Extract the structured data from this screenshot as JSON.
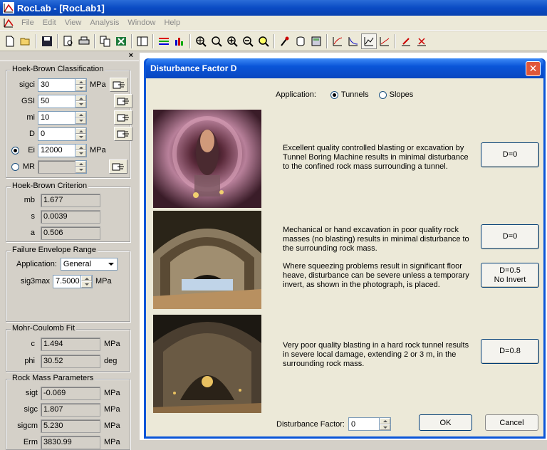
{
  "window": {
    "title": "RocLab - [RocLab1]"
  },
  "menu": [
    "File",
    "Edit",
    "View",
    "Analysis",
    "Window",
    "Help"
  ],
  "toolbar": {
    "icons": [
      "new-icon",
      "open-icon",
      "save-icon",
      "print-preview-icon",
      "print-icon",
      "copy-icon",
      "excel-icon",
      "panel-icon",
      "color-icon",
      "chart-icon",
      "zoom-all-icon",
      "zoom-icon",
      "zoom-in-icon",
      "zoom-out-icon",
      "zoom-extents-icon",
      "tool-icon",
      "cylinder-icon",
      "calculator-icon",
      "plot1-icon",
      "plot2-icon",
      "plot3-icon",
      "plot4-icon",
      "edit-icon",
      "pick-icon"
    ]
  },
  "hoek_brown_classification": {
    "title": "Hoek-Brown Classification",
    "sigci": {
      "label": "sigci",
      "value": "30",
      "unit": "MPa"
    },
    "gsi": {
      "label": "GSI",
      "value": "50"
    },
    "mi": {
      "label": "mi",
      "value": "10"
    },
    "d": {
      "label": "D",
      "value": "0"
    },
    "ei": {
      "label": "Ei",
      "value": "12000",
      "unit": "MPa"
    },
    "mr": {
      "label": "MR",
      "value": ""
    }
  },
  "hoek_brown_criterion": {
    "title": "Hoek-Brown Criterion",
    "mb": {
      "label": "mb",
      "value": "1.677"
    },
    "s": {
      "label": "s",
      "value": "0.0039"
    },
    "a": {
      "label": "a",
      "value": "0.506"
    }
  },
  "failure_envelope": {
    "title": "Failure Envelope Range",
    "application_label": "Application:",
    "application_value": "General",
    "sig3max_label": "sig3max",
    "sig3max_value": "7.5000",
    "unit": "MPa"
  },
  "mohr_coulomb": {
    "title": "Mohr-Coulomb Fit",
    "c": {
      "label": "c",
      "value": "1.494",
      "unit": "MPa"
    },
    "phi": {
      "label": "phi",
      "value": "30.52",
      "unit": "deg"
    }
  },
  "rock_mass": {
    "title": "Rock Mass Parameters",
    "sigt": {
      "label": "sigt",
      "value": "-0.069",
      "unit": "MPa"
    },
    "sigc": {
      "label": "sigc",
      "value": "1.807",
      "unit": "MPa"
    },
    "sigcm": {
      "label": "sigcm",
      "value": "5.230",
      "unit": "MPa"
    },
    "erm": {
      "label": "Erm",
      "value": "3830.99",
      "unit": "MPa"
    }
  },
  "dialog": {
    "title": "Disturbance Factor D",
    "application_label": "Application:",
    "opt_tunnels": "Tunnels",
    "opt_slopes": "Slopes",
    "desc1": "Excellent quality controlled blasting or excavation by Tunnel Boring Machine results in minimal disturbance to the confined rock mass surrounding a tunnel.",
    "btn1": "D=0",
    "desc2": "Mechanical or hand excavation in poor quality rock masses (no blasting) results in minimal disturbance to the surrounding rock mass.",
    "btn2": "D=0",
    "desc3": "Where squeezing problems result in significant floor heave, disturbance can be severe unless a temporary invert, as shown in the photograph, is placed.",
    "btn3_line1": "D=0.5",
    "btn3_line2": "No Invert",
    "desc4": "Very poor quality blasting in a hard rock tunnel results in severe local damage, extending 2 or 3 m, in the surrounding rock mass.",
    "btn4": "D=0.8",
    "df_label": "Disturbance Factor:",
    "df_value": "0",
    "ok": "OK",
    "cancel": "Cancel"
  }
}
